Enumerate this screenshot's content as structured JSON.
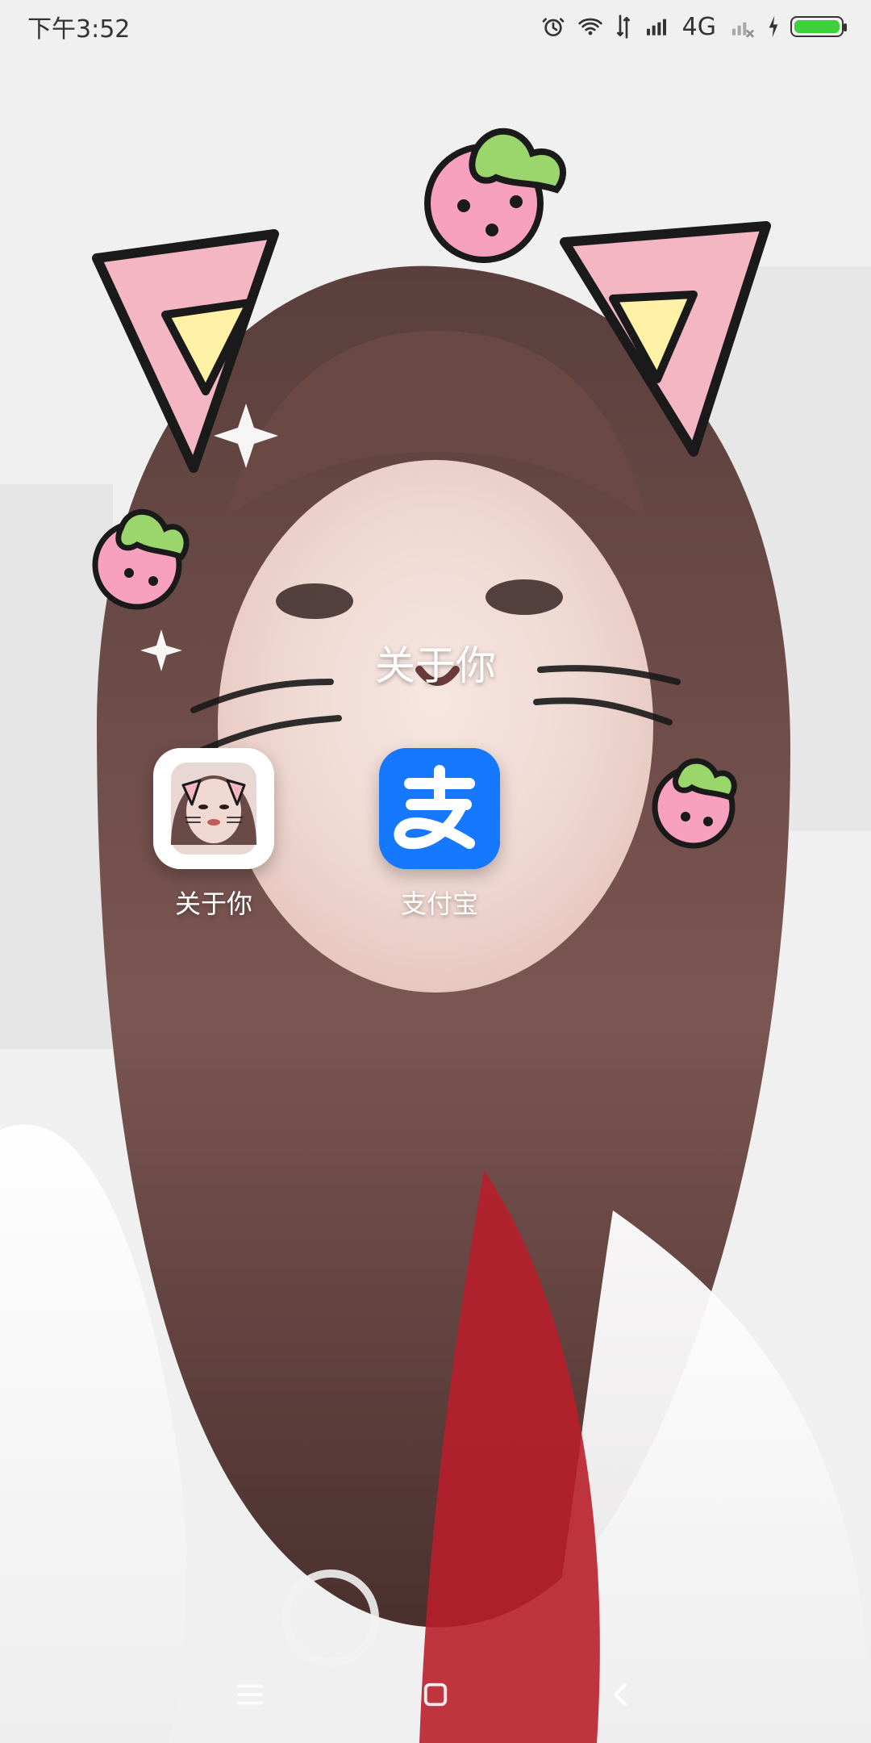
{
  "status_bar": {
    "time": "下午3:52",
    "network_label": "4G"
  },
  "folder": {
    "title": "关于你",
    "apps": [
      {
        "label": "关于你",
        "icon": "photo-app-icon"
      },
      {
        "label": "支付宝",
        "icon": "alipay-icon"
      }
    ]
  },
  "nav": {
    "items": [
      "menu-icon",
      "home-icon",
      "back-icon"
    ]
  },
  "colors": {
    "battery_fill": "#3fd13b",
    "alipay_blue": "#1677ff"
  }
}
